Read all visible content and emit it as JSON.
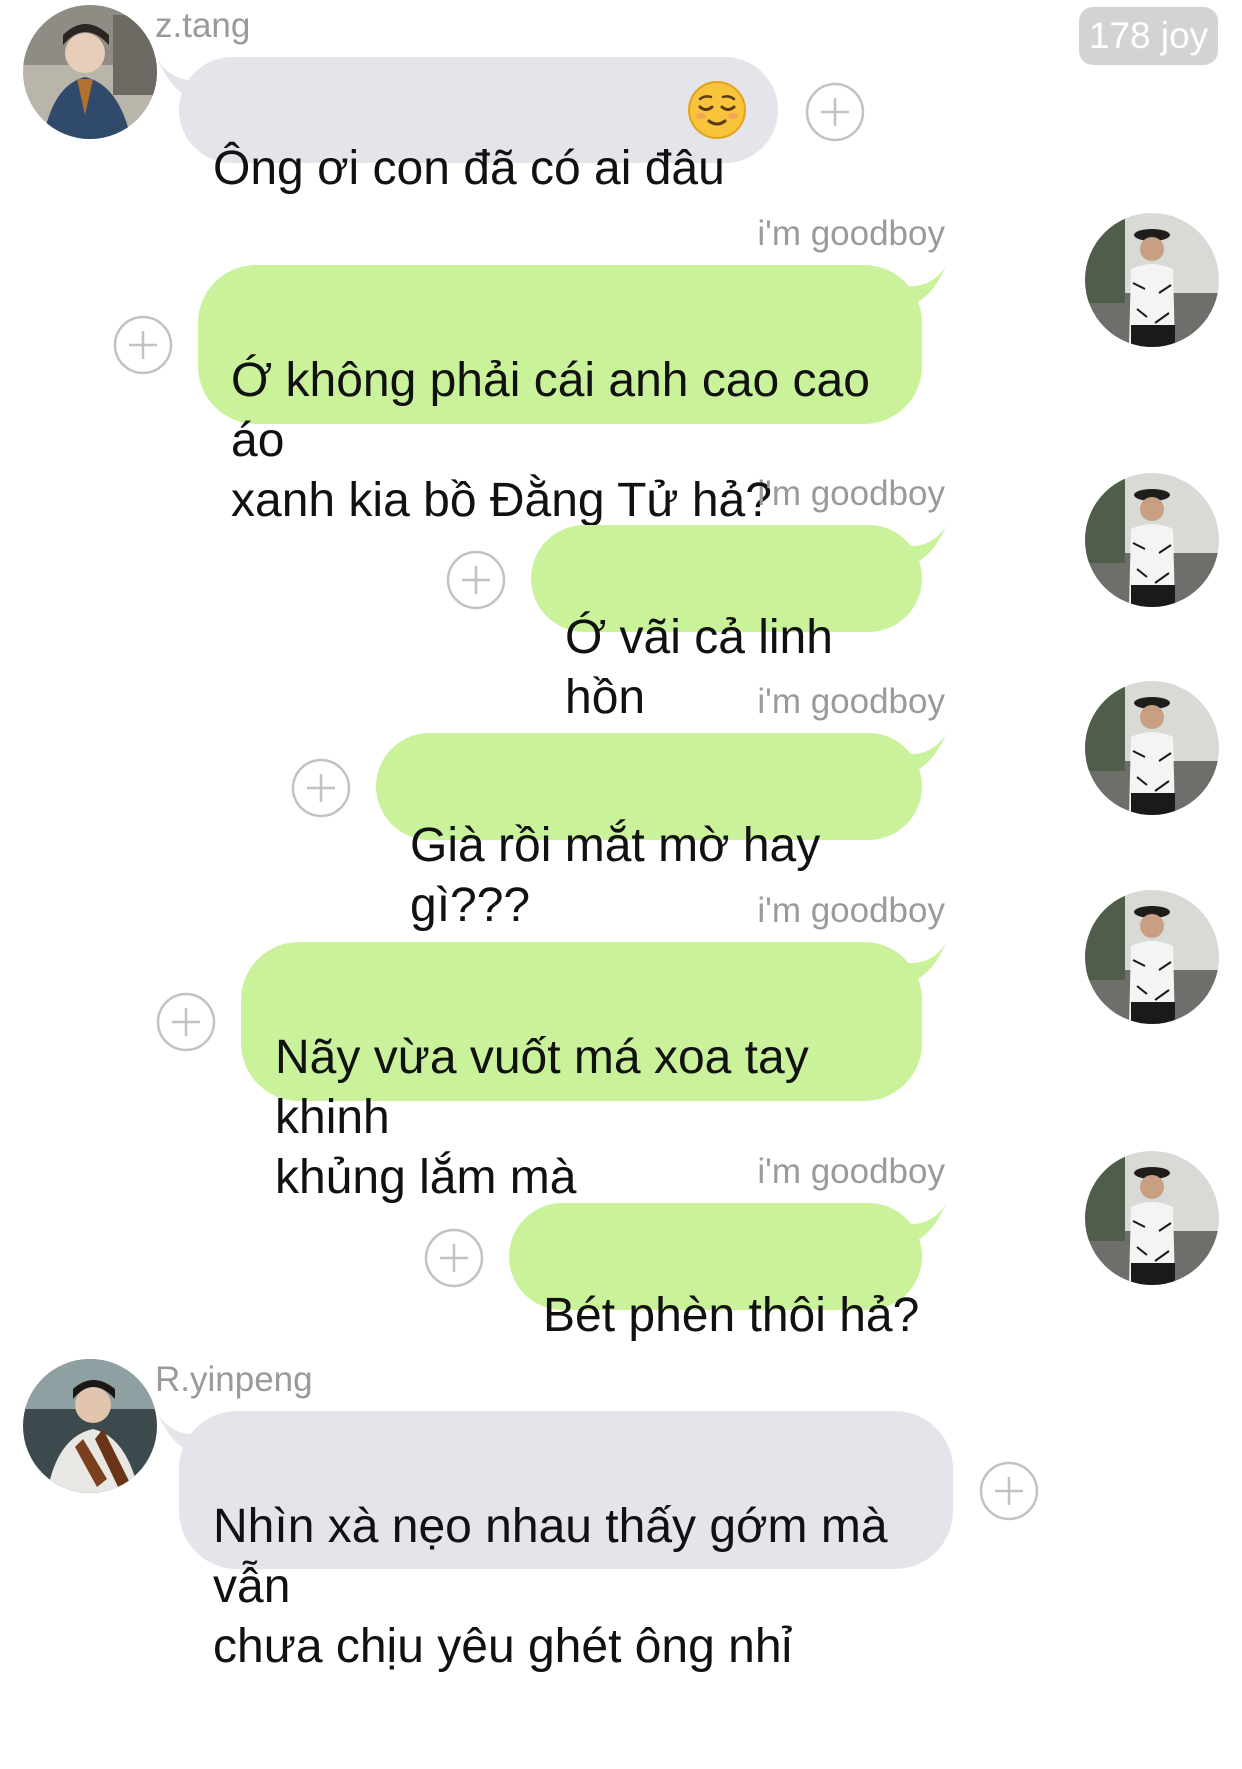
{
  "header": {
    "badge": "178 joy"
  },
  "messages": [
    {
      "sender": "z.tang",
      "text": "Ông ơi con đã có ai đâu",
      "emoji": "relieved-face"
    },
    {
      "sender": "i'm goodboy",
      "text": "Ớ không phải cái anh cao cao áo\nxanh kia bồ Đằng Tử hả?"
    },
    {
      "sender": "i'm goodboy",
      "text": "Ớ vãi cả linh hồn"
    },
    {
      "sender": "i'm goodboy",
      "text": "Già rồi mắt mờ hay gì???"
    },
    {
      "sender": "i'm goodboy",
      "text": "Nãy vừa vuốt má xoa tay khinh\nkhủng lắm mà"
    },
    {
      "sender": "i'm goodboy",
      "text": "Bét phèn thôi hả?"
    },
    {
      "sender": "R.yinpeng",
      "text": "Nhìn xà nẹo nhau thấy gớm mà vẫn\nchưa chịu yêu ghét ông nhỉ"
    }
  ],
  "colors": {
    "incoming_bubble": "#e4e5ea",
    "outgoing_bubble": "#c9f29b",
    "name_text": "#9a9a9e",
    "badge_bg": "#d3d3d6"
  },
  "icons": {
    "react": "plus-circle-icon",
    "avatar": "profile-photo"
  }
}
